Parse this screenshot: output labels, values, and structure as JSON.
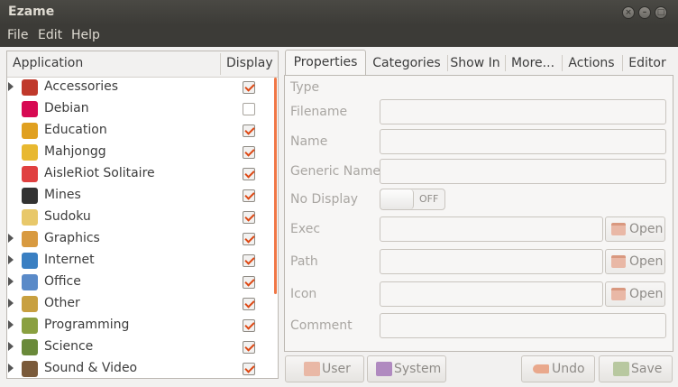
{
  "window": {
    "title": "Ezame"
  },
  "menu": [
    "File",
    "Edit",
    "Help"
  ],
  "tree": {
    "columns": {
      "application": "Application",
      "display": "Display"
    },
    "rows": [
      {
        "label": "Accessories",
        "expandable": true,
        "checked": true,
        "icon": "accessories-icon",
        "color": "#c0392b"
      },
      {
        "label": "Debian",
        "expandable": false,
        "checked": false,
        "icon": "debian-icon",
        "color": "#d70a53"
      },
      {
        "label": "Education",
        "expandable": false,
        "checked": true,
        "icon": "education-icon",
        "color": "#e0a020"
      },
      {
        "label": "Mahjongg",
        "expandable": false,
        "checked": true,
        "icon": "mahjongg-icon",
        "color": "#e8b830"
      },
      {
        "label": "AisleRiot Solitaire",
        "expandable": false,
        "checked": true,
        "icon": "solitaire-icon",
        "color": "#e04040"
      },
      {
        "label": "Mines",
        "expandable": false,
        "checked": true,
        "icon": "mines-icon",
        "color": "#333333"
      },
      {
        "label": "Sudoku",
        "expandable": false,
        "checked": true,
        "icon": "sudoku-icon",
        "color": "#e8c86a"
      },
      {
        "label": "Graphics",
        "expandable": true,
        "checked": true,
        "icon": "graphics-icon",
        "color": "#d89a40"
      },
      {
        "label": "Internet",
        "expandable": true,
        "checked": true,
        "icon": "internet-icon",
        "color": "#3a7fc2"
      },
      {
        "label": "Office",
        "expandable": true,
        "checked": true,
        "icon": "office-icon",
        "color": "#5a8ac8"
      },
      {
        "label": "Other",
        "expandable": true,
        "checked": true,
        "icon": "other-icon",
        "color": "#c8a040"
      },
      {
        "label": "Programming",
        "expandable": true,
        "checked": true,
        "icon": "programming-icon",
        "color": "#8aa040"
      },
      {
        "label": "Science",
        "expandable": true,
        "checked": true,
        "icon": "science-icon",
        "color": "#6a8a3a"
      },
      {
        "label": "Sound & Video",
        "expandable": true,
        "checked": true,
        "icon": "sound-video-icon",
        "color": "#7a5a3a"
      }
    ]
  },
  "tabs": [
    "Properties",
    "Categories",
    "Show In",
    "More...",
    "Actions",
    "Editor"
  ],
  "properties": {
    "type_label": "Type",
    "filename_label": "Filename",
    "name_label": "Name",
    "generic_name_label": "Generic Name",
    "no_display_label": "No Display",
    "no_display_state": "OFF",
    "exec_label": "Exec",
    "path_label": "Path",
    "icon_label": "Icon",
    "comment_label": "Comment",
    "open_label": "Open"
  },
  "bottom": {
    "user": "User",
    "system": "System",
    "undo": "Undo",
    "save": "Save"
  },
  "colors": {
    "accent": "#dd4814",
    "titlebar": "#3c3b37"
  }
}
